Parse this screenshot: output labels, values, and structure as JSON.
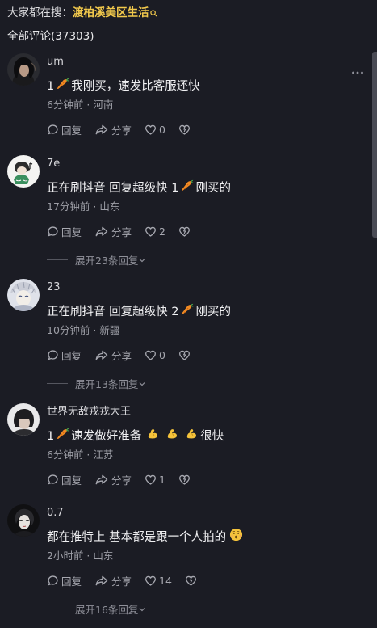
{
  "header": {
    "search_prefix": "大家都在搜：",
    "search_query": "渡柏溪美区生活",
    "comment_count": "全部评论(37303)"
  },
  "comments": [
    {
      "username": "um",
      "text_a": "1",
      "text_b": "我刚买，速发比客服还快",
      "time": "6分钟前 · 河南",
      "reply": "回复",
      "share": "分享",
      "likes": "0"
    },
    {
      "username": "7e",
      "text_a": "正在刷抖音 回复超级快 1",
      "text_b": "刚买的",
      "time": "17分钟前 · 山东",
      "reply": "回复",
      "share": "分享",
      "likes": "2",
      "expand": "展开23条回复"
    },
    {
      "username": "23",
      "text_a": "正在刷抖音 回复超级快 2",
      "text_b": "刚买的",
      "time": "10分钟前 · 新疆",
      "reply": "回复",
      "share": "分享",
      "likes": "0",
      "expand": "展开13条回复"
    },
    {
      "username": "世界无敌戎戎大王",
      "text_a": "1",
      "text_b": "速发做好准备",
      "text_c": "很快",
      "time": "6分钟前 · 江苏",
      "reply": "回复",
      "share": "分享",
      "likes": "1"
    },
    {
      "username": "0.7",
      "text_a": "都在推特上  基本都是跟一个人拍的",
      "time": "2小时前 · 山东",
      "reply": "回复",
      "share": "分享",
      "likes": "14",
      "expand": "展开16条回复"
    }
  ],
  "colors": {
    "background": "#1b1c24",
    "search_accent": "#f2c94c",
    "text_primary": "#f0f0f2",
    "text_secondary": "#9d9ea6"
  },
  "icons": {
    "reply": "speech-bubble-icon",
    "share": "share-arrow-icon",
    "like": "heart-icon",
    "dislike": "broken-heart-icon",
    "more": "more-dots-icon",
    "search": "search-icon",
    "carrot": "carrot-emoji",
    "flex": "flexed-biceps-emoji",
    "hushed": "hushed-face-emoji"
  }
}
